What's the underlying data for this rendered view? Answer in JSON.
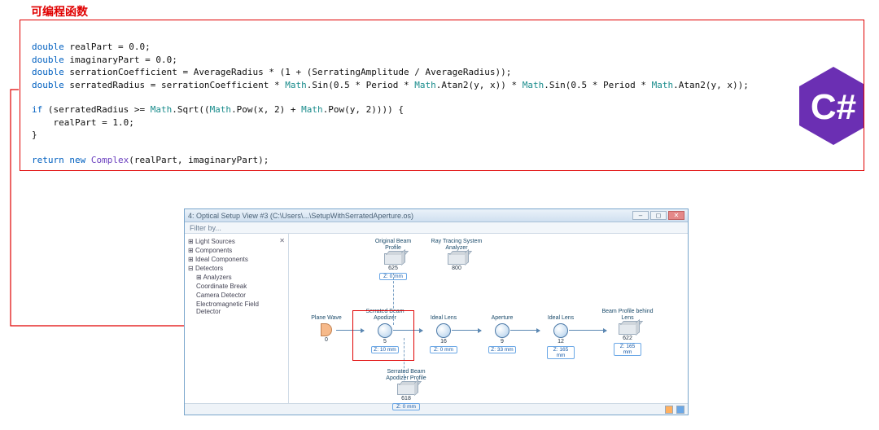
{
  "title_red": "可编程函数",
  "code": {
    "l1a": "double",
    "l1b": " realPart = 0.0;",
    "l2a": "double",
    "l2b": " imaginaryPart = 0.0;",
    "l3a": "double",
    "l3b": " serrationCoefficient = AverageRadius * (1 + (SerratingAmplitude / AverageRadius));",
    "l4a": "double",
    "l4b": " serratedRadius = serrationCoefficient * ",
    "l4c": "Math",
    "l4d": ".Sin(0.5 * Period * ",
    "l4e": "Math",
    "l4f": ".Atan2(y, x)) * ",
    "l4g": "Math",
    "l4h": ".Sin(0.5 * Period * ",
    "l4i": "Math",
    "l4j": ".Atan2(y, x));",
    "l5a": "if",
    "l5b": " (serratedRadius >= ",
    "l5c": "Math",
    "l5d": ".Sqrt((",
    "l5e": "Math",
    "l5f": ".Pow(x, 2) + ",
    "l5g": "Math",
    "l5h": ".Pow(y, 2)))) {",
    "l6": "    realPart = 1.0;",
    "l7": "}",
    "l8a": "return new ",
    "l8b": "Complex",
    "l8c": "(realPart, imaginaryPart);"
  },
  "csharp": {
    "glyph": "C#"
  },
  "optics": {
    "title": "4: Optical Setup View #3 (C:\\Users\\...\\SetupWithSerratedAperture.os)",
    "toolbar_label": "Filter by...",
    "sidebar": {
      "items": [
        "Light Sources",
        "Components",
        "Ideal Components",
        "Detectors",
        "Analyzers",
        "Coordinate Break",
        "Camera Detector",
        "Electromagnetic Field Detector"
      ]
    },
    "nodes": {
      "plane_wave": {
        "label": "Plane Wave",
        "idx": "0",
        "dist": ""
      },
      "apodizer": {
        "label": "Serrated Beam Apodizer",
        "idx": "5",
        "dist": "Z: 10 mm"
      },
      "ideal_lens1": {
        "label": "Ideal Lens",
        "idx": "16",
        "dist": "Z: 0 mm"
      },
      "aperture": {
        "label": "Aperture",
        "idx": "9",
        "dist": "Z: 33 mm"
      },
      "ideal_lens2": {
        "label": "Ideal Lens",
        "idx": "12",
        "dist": "Z: 165 mm"
      },
      "beam_behind": {
        "label": "Beam Profile behind Lens",
        "idx": "622",
        "dist": "Z: 165 mm"
      },
      "orig_profile": {
        "label": "Original Beam Profile",
        "idx": "625",
        "dist": "Z: 0 mm"
      },
      "ray_analyzer": {
        "label": "Ray Tracing System Analyzer",
        "idx": "800",
        "dist": ""
      },
      "serr_profile": {
        "label": "Serrated Beam Apodizer Profile",
        "idx": "618",
        "dist": "Z: 0 mm"
      }
    }
  }
}
